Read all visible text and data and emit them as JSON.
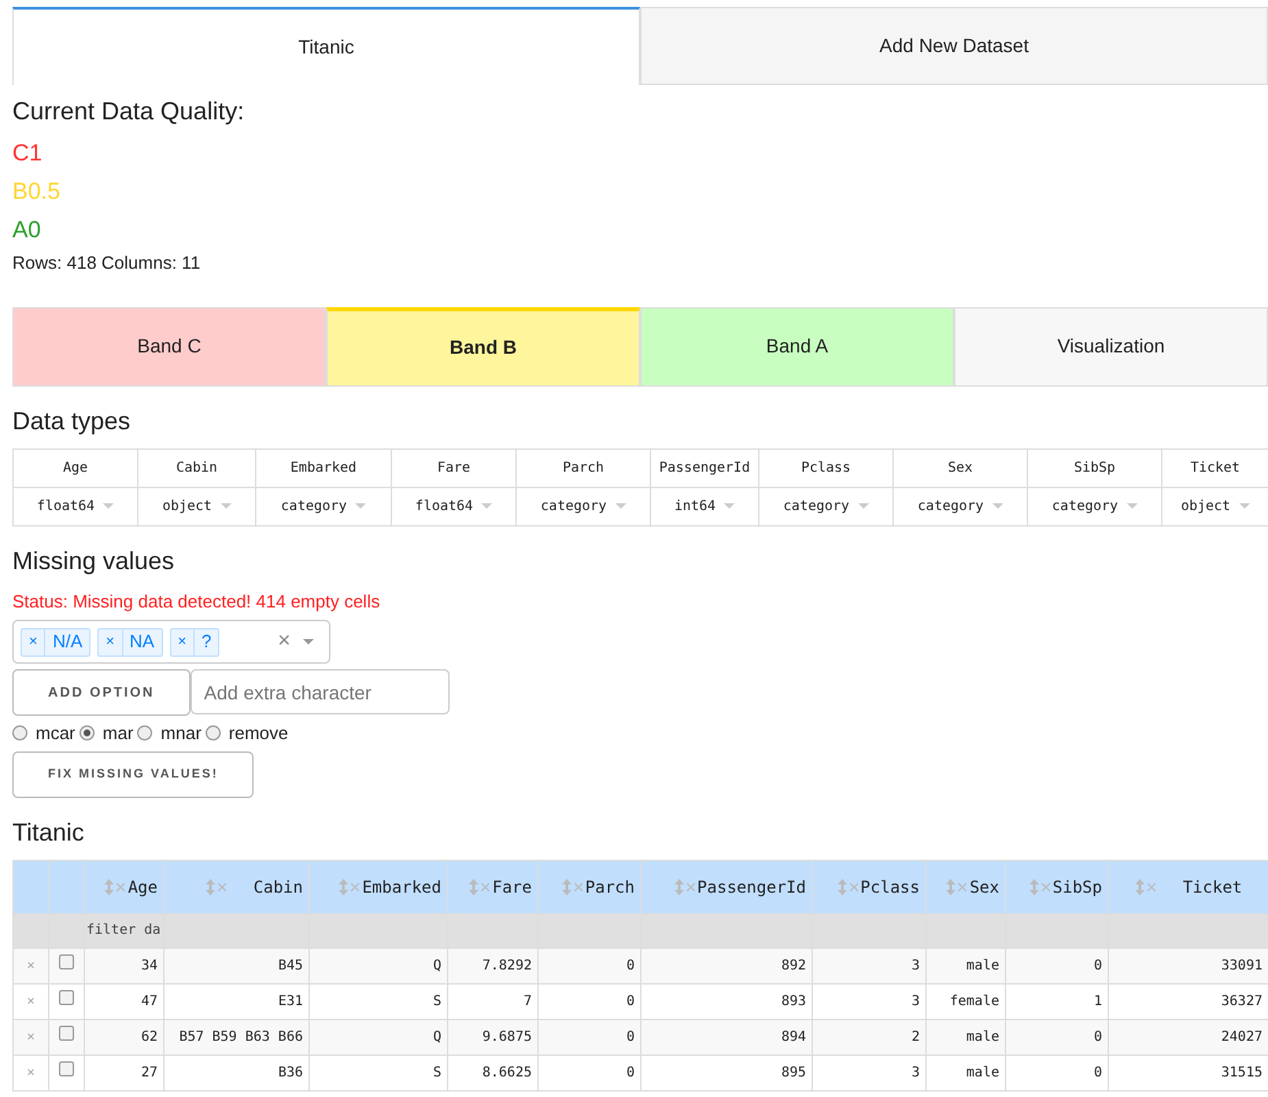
{
  "tabs": [
    {
      "label": "Titanic",
      "selected": true
    },
    {
      "label": "Add New Dataset",
      "selected": false
    }
  ],
  "quality": {
    "title": "Current Data Quality:",
    "grades": [
      {
        "text": "C1",
        "color": "#ff3333"
      },
      {
        "text": "B0.5",
        "color": "#ffd530"
      },
      {
        "text": "A0",
        "color": "#2ca02c"
      }
    ],
    "summary": "Rows: 418 Columns: 11"
  },
  "bands": [
    {
      "label": "Band C",
      "color": "#ffcccc",
      "selected": false
    },
    {
      "label": "Band B",
      "color": "#fff59d",
      "selected": true
    },
    {
      "label": "Band A",
      "color": "#c8ffc0",
      "selected": false
    },
    {
      "label": "Visualization",
      "color": "#f7f7f7",
      "selected": false
    }
  ],
  "data_types": {
    "title": "Data types",
    "columns": [
      {
        "name": "Age",
        "dtype": "float64"
      },
      {
        "name": "Cabin",
        "dtype": "object"
      },
      {
        "name": "Embarked",
        "dtype": "category"
      },
      {
        "name": "Fare",
        "dtype": "float64"
      },
      {
        "name": "Parch",
        "dtype": "category"
      },
      {
        "name": "PassengerId",
        "dtype": "int64"
      },
      {
        "name": "Pclass",
        "dtype": "category"
      },
      {
        "name": "Sex",
        "dtype": "category"
      },
      {
        "name": "SibSp",
        "dtype": "category"
      },
      {
        "name": "Ticket",
        "dtype": "object"
      }
    ]
  },
  "missing": {
    "title": "Missing values",
    "status": "Status: Missing data detected! 414 empty cells",
    "tags": [
      "N/A",
      "NA",
      "?"
    ],
    "tag_remove": "×",
    "clear": "×",
    "add_button": "ADD OPTION",
    "add_placeholder": "Add extra character",
    "methods": [
      {
        "label": "mcar",
        "selected": false
      },
      {
        "label": "mar",
        "selected": true
      },
      {
        "label": "mnar",
        "selected": false
      },
      {
        "label": "remove",
        "selected": false
      }
    ],
    "fix_button": "FIX MISSING VALUES!"
  },
  "table": {
    "title": "Titanic",
    "filter_placeholder": "filter da",
    "delete_mark": "×",
    "columns": [
      "Age",
      "Cabin",
      "Embarked",
      "Fare",
      "Parch",
      "PassengerId",
      "Pclass",
      "Sex",
      "SibSp",
      "Ticket"
    ],
    "rows": [
      {
        "checked": false,
        "cells": [
          "34",
          "B45",
          "Q",
          "7.8292",
          "0",
          "892",
          "3",
          "male",
          "0",
          "33091"
        ]
      },
      {
        "checked": false,
        "cells": [
          "47",
          "E31",
          "S",
          "7",
          "0",
          "893",
          "3",
          "female",
          "1",
          "36327"
        ]
      },
      {
        "checked": false,
        "cells": [
          "62",
          "B57 B59 B63 B66",
          "Q",
          "9.6875",
          "0",
          "894",
          "2",
          "male",
          "0",
          "24027"
        ]
      },
      {
        "checked": false,
        "cells": [
          "27",
          "B36",
          "S",
          "8.6625",
          "0",
          "895",
          "3",
          "male",
          "0",
          "31515"
        ]
      }
    ]
  }
}
